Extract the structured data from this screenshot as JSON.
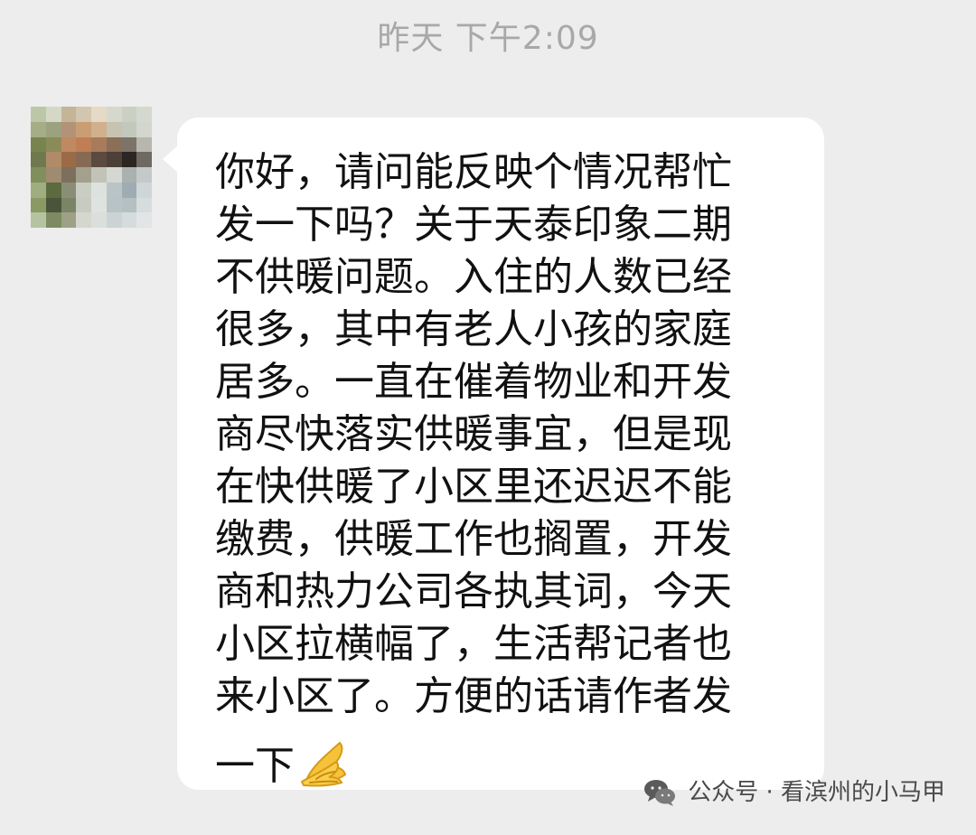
{
  "header": {
    "timestamp": "昨天 下午2:09"
  },
  "chat": {
    "avatar_icon": "blurred-avatar-icon",
    "message_lines": [
      "你好，请问能反映个情况帮忙",
      "发一下吗？关于天泰印象二期",
      "不供暖问题。入住的人数已经",
      "很多，其中有老人小孩的家庭",
      "居多。一直在催着物业和开发",
      "商尽快落实供暖事宜，但是现",
      "在快供暖了小区里还迟迟不能",
      "缴费，供暖工作也搁置，开发",
      "商和热力公司各执其词，今天",
      "小区拉横幅了，生活帮记者也",
      "来小区了。方便的话请作者发",
      "一下"
    ],
    "emoji_icon": "folded-hands-icon"
  },
  "watermark": {
    "icon": "wechat-icon",
    "text": "公众号 · 看滨州的小马甲"
  },
  "colors": {
    "background": "#ededed",
    "bubble": "#ffffff",
    "message_text": "#111111",
    "timestamp_text": "#a8a8a8",
    "watermark_text": "#4a4a4a"
  }
}
